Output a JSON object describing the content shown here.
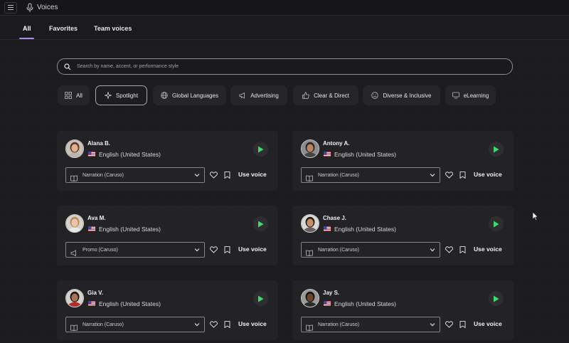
{
  "topbar": {
    "title": "Voices"
  },
  "tabs": [
    {
      "label": "All",
      "active": true
    },
    {
      "label": "Favorites",
      "active": false
    },
    {
      "label": "Team voices",
      "active": false
    }
  ],
  "search": {
    "placeholder": "Search by name, accent, or performance style"
  },
  "filters": [
    {
      "label": "All",
      "icon": "grid-icon"
    },
    {
      "label": "Spotlight",
      "icon": "sparkle-icon",
      "active": true
    },
    {
      "label": "Global Languages",
      "icon": "globe-icon"
    },
    {
      "label": "Advertising",
      "icon": "megaphone-icon"
    },
    {
      "label": "Clear & Direct",
      "icon": "thumbs-up-icon"
    },
    {
      "label": "Diverse & Inclusive",
      "icon": "smile-icon"
    },
    {
      "label": "eLearning",
      "icon": "monitor-icon"
    }
  ],
  "voices": [
    {
      "name": "Alana B.",
      "language": "English (United States)",
      "style": "Narration (Caruso)",
      "style_icon": "book-icon",
      "use_label": "Use voice"
    },
    {
      "name": "Antony A.",
      "language": "English (United States)",
      "style": "Narration (Caruso)",
      "style_icon": "book-icon",
      "use_label": "Use voice"
    },
    {
      "name": "Ava M.",
      "language": "English (United States)",
      "style": "Promo (Caruso)",
      "style_icon": "megaphone-icon",
      "use_label": "Use voice"
    },
    {
      "name": "Chase J.",
      "language": "English (United States)",
      "style": "Narration (Caruso)",
      "style_icon": "book-icon",
      "use_label": "Use voice"
    },
    {
      "name": "Gia V.",
      "language": "English (United States)",
      "style": "Narration (Caruso)",
      "style_icon": "book-icon",
      "use_label": "Use voice"
    },
    {
      "name": "Jay S.",
      "language": "English (United States)",
      "style": "Narration (Caruso)",
      "style_icon": "book-icon",
      "use_label": "Use voice"
    }
  ],
  "colors": {
    "accent": "#a98df0",
    "play": "#3ddc6e",
    "background": "#1b1b1d",
    "card": "#232325"
  }
}
